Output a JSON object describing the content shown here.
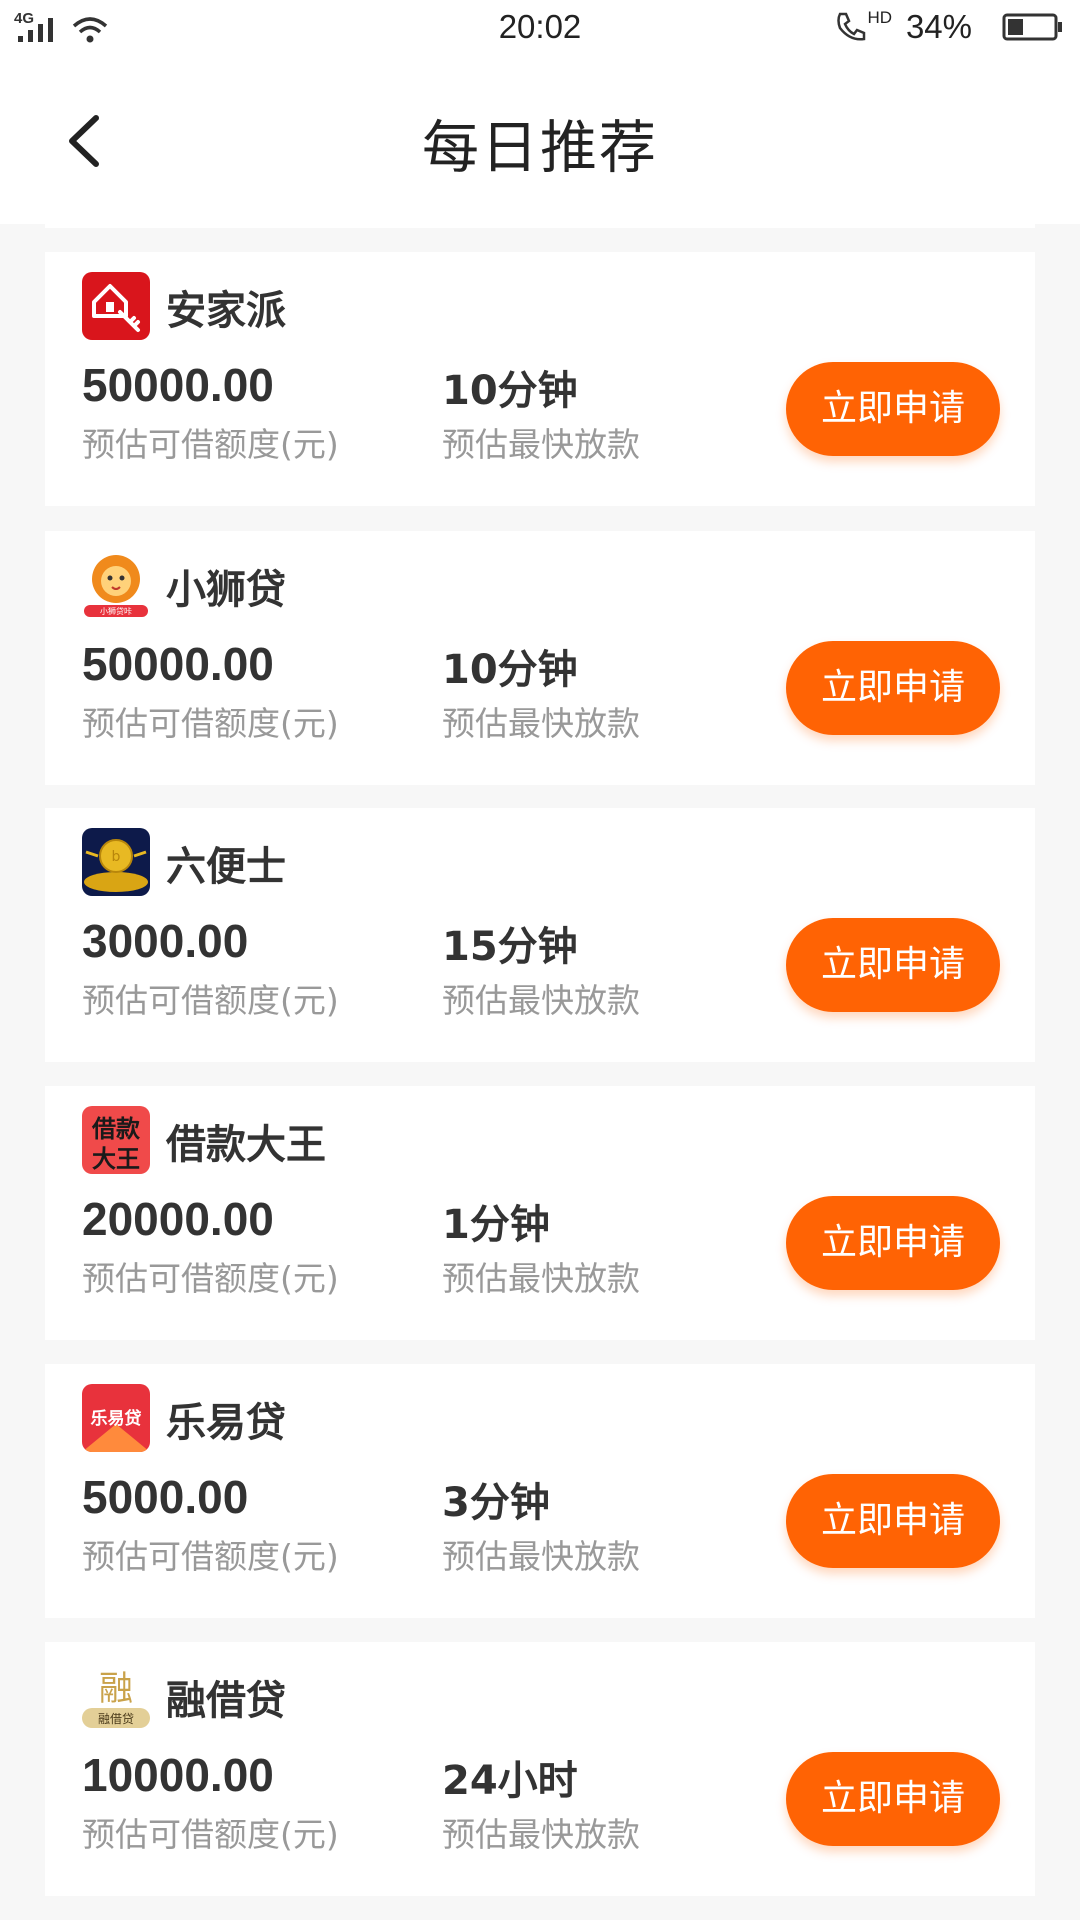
{
  "status_bar": {
    "network": "4G",
    "time": "20:02",
    "call_hd": "HD",
    "battery": "34%",
    "battery_level": 0.34
  },
  "nav": {
    "title": "每日推荐"
  },
  "products": [
    {
      "name": "安家派",
      "icon": "anjiapai-logo",
      "amount": "50000.00",
      "amount_label": "预估可借额度(元)",
      "speed": "10分钟",
      "speed_label": "预估最快放款",
      "apply_label": "立即申请"
    },
    {
      "name": "小狮贷",
      "icon": "xiaoshidai-logo",
      "logo_text": "小狮贷咔",
      "amount": "50000.00",
      "amount_label": "预估可借额度(元)",
      "speed": "10分钟",
      "speed_label": "预估最快放款",
      "apply_label": "立即申请"
    },
    {
      "name": "六便士",
      "icon": "liubianshi-logo",
      "amount": "3000.00",
      "amount_label": "预估可借额度(元)",
      "speed": "15分钟",
      "speed_label": "预估最快放款",
      "apply_label": "立即申请"
    },
    {
      "name": "借款大王",
      "icon": "jiekuandawang-logo",
      "logo_text": "借款大王",
      "amount": "20000.00",
      "amount_label": "预估可借额度(元)",
      "speed": "1分钟",
      "speed_label": "预估最快放款",
      "apply_label": "立即申请"
    },
    {
      "name": "乐易贷",
      "icon": "leyidai-logo",
      "logo_text": "乐易贷",
      "amount": "5000.00",
      "amount_label": "预估可借额度(元)",
      "speed": "3分钟",
      "speed_label": "预估最快放款",
      "apply_label": "立即申请"
    },
    {
      "name": "融借贷",
      "icon": "rongjiedai-logo",
      "logo_text": "融借贷",
      "amount": "10000.00",
      "amount_label": "预估可借额度(元)",
      "speed": "24小时",
      "speed_label": "预估最快放款",
      "apply_label": "立即申请"
    }
  ],
  "colors": {
    "accent": "#ff6304",
    "background": "#f7f7f7",
    "card": "#ffffff",
    "text_primary": "#333333",
    "text_secondary": "#999999"
  }
}
